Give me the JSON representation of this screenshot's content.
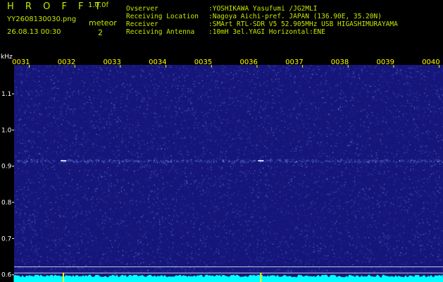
{
  "header": {
    "app_title": "H R O F F T",
    "version": "1.0.0f",
    "filename": "YY2608130030.png",
    "datetime": "26.08.13 00:30",
    "meteor_label": "meteor",
    "meteor_count": "2"
  },
  "info": [
    {
      "key": "Ovserver",
      "value": ":YOSHIKAWA Yasufumi /JG2MLI"
    },
    {
      "key": "Receiving Location",
      "value": ":Nagoya Aichi-pref. JAPAN (136.90E, 35.20N)"
    },
    {
      "key": "Receiver",
      "value": ":SMArt RTL-SDR V5 52.905MHz USB HIGASHIMURAYAMA"
    },
    {
      "key": "Receiving Antenna",
      "value": ":10mH 3el.YAGI Horizontal:ENE"
    }
  ],
  "chart_data": {
    "type": "heatmap",
    "ylabel": "kHz",
    "time_ticks": [
      "0031",
      "0032",
      "0033",
      "0034",
      "0035",
      "0036",
      "0037",
      "0038",
      "0039",
      "0040"
    ],
    "freq_ticks": [
      "1.1",
      "1.0",
      "0.9",
      "0.8",
      "0.7",
      "0.6"
    ],
    "ylim": [
      0.58,
      1.18
    ],
    "freq_tick_values": [
      1.1,
      1.0,
      0.9,
      0.8,
      0.7,
      0.6
    ],
    "signal_band_khz": 0.915,
    "meteor_events": [
      {
        "time": "00:31:45",
        "freq_khz": 0.915
      },
      {
        "time": "00:36:05",
        "freq_khz": 0.915
      }
    ],
    "colors": {
      "background": "#16167a",
      "noise": "#4f6fd6",
      "tick": "#ffff00",
      "grid": "#ffffff",
      "power": "#00ffff"
    }
  }
}
